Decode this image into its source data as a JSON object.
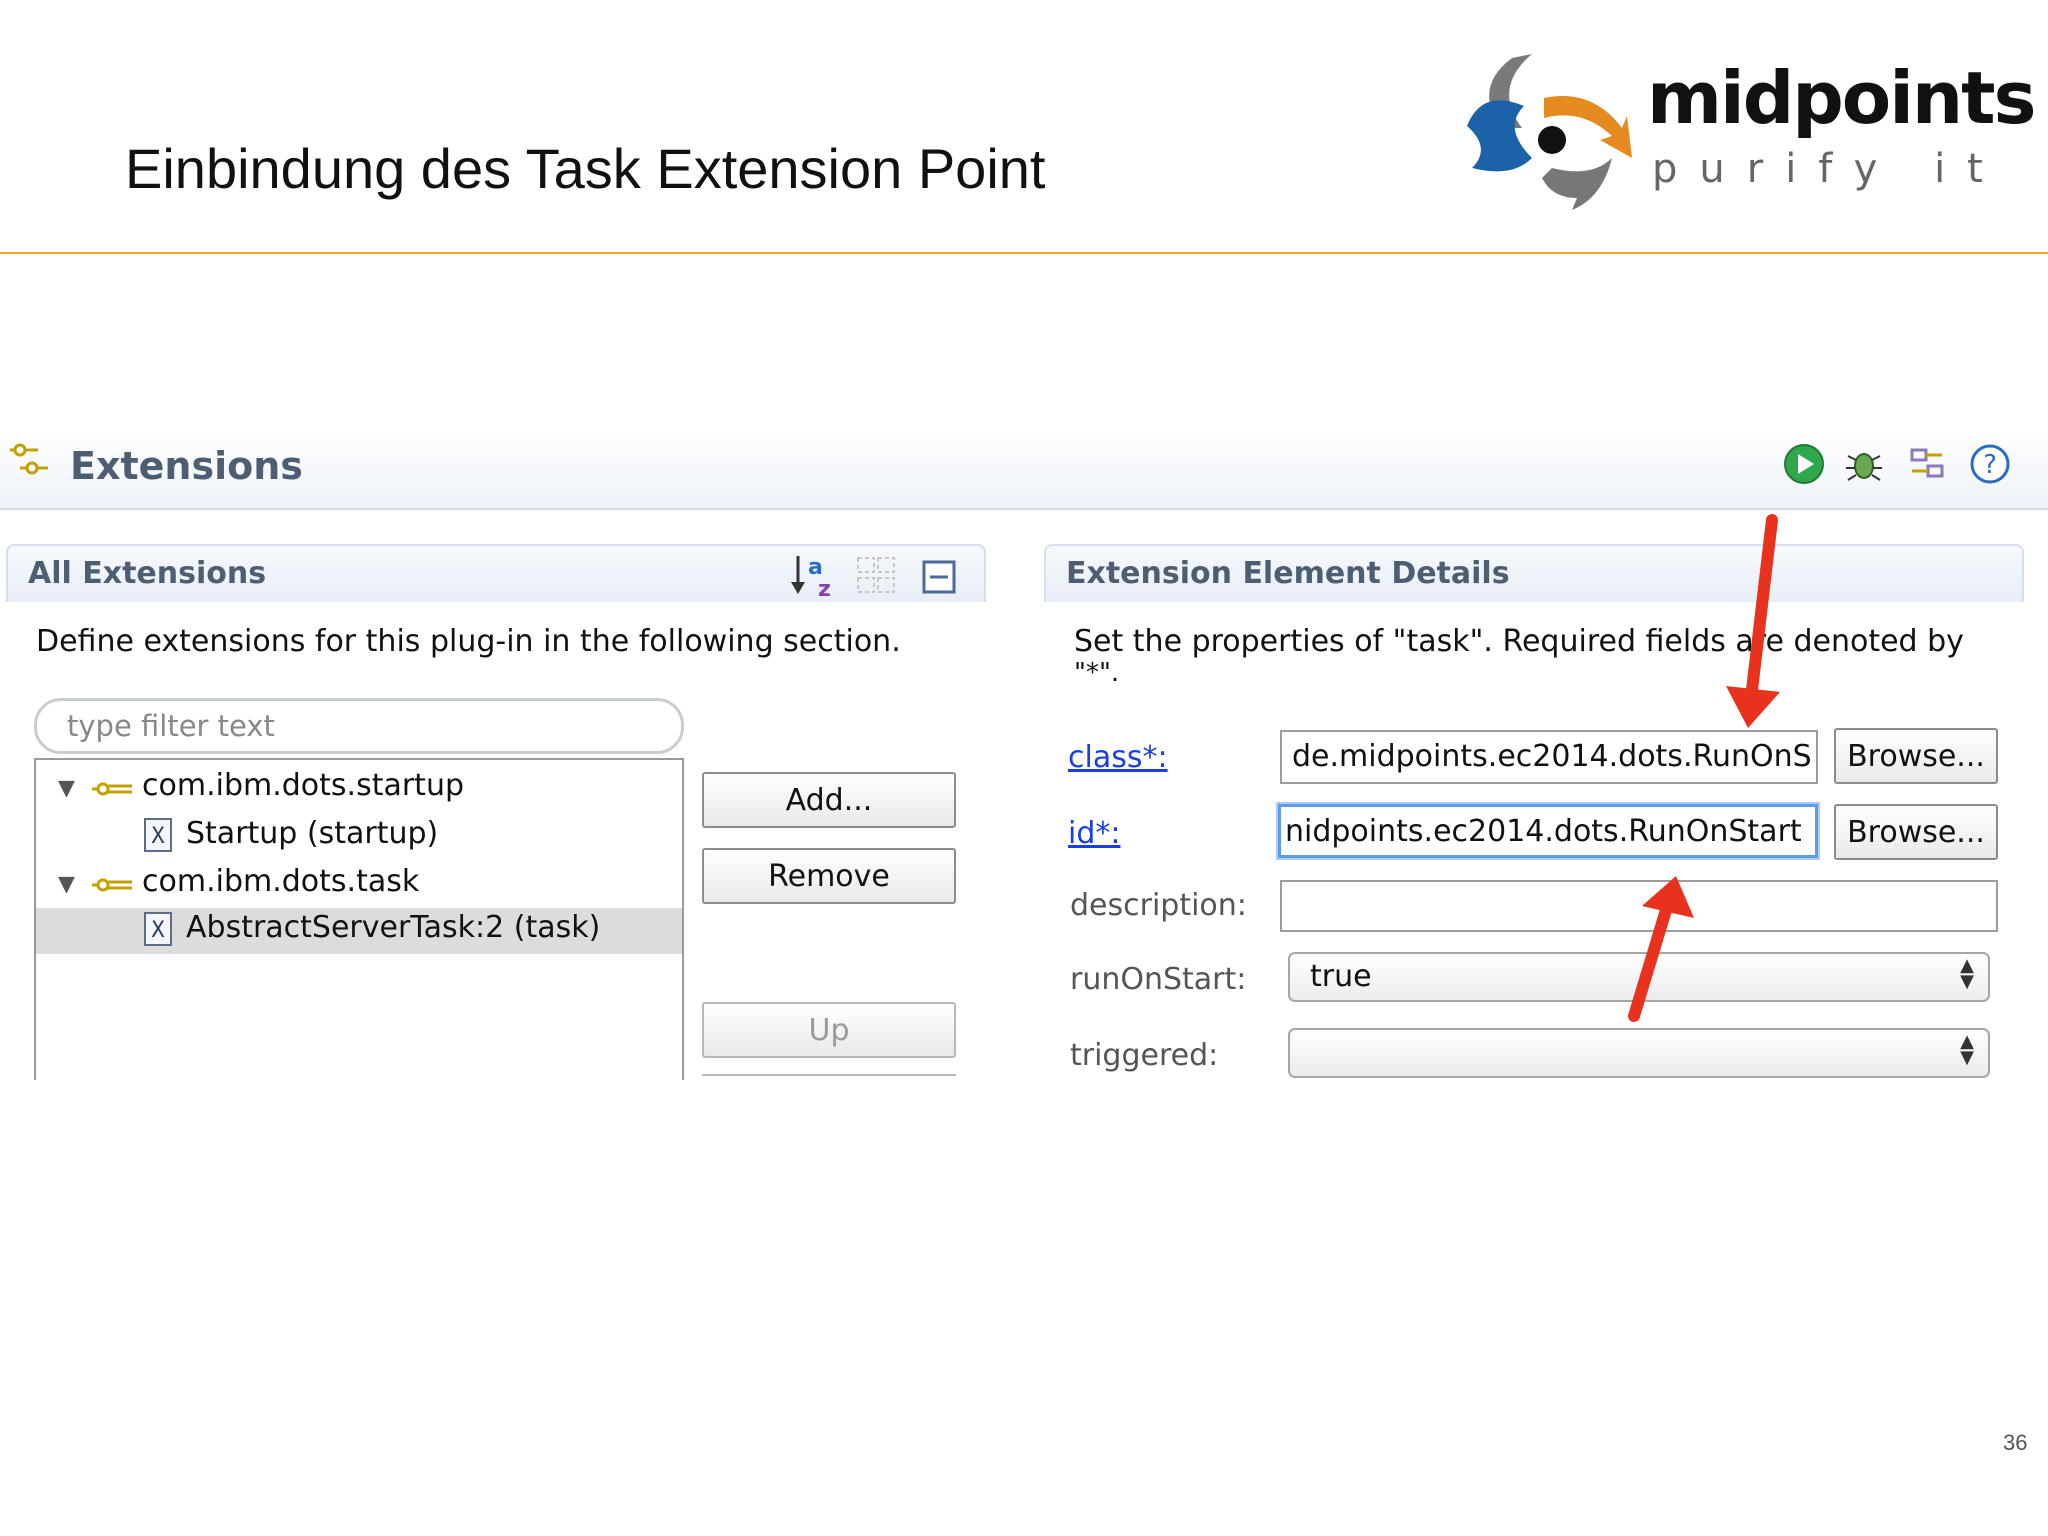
{
  "slide": {
    "title": "Einbindung des Task Extension Point",
    "number": "36",
    "logo": {
      "name": "midpoints",
      "tagline": "purify it"
    }
  },
  "editor": {
    "title": "Extensions",
    "toolbar_icons": [
      "run-icon",
      "debug-icon",
      "extension-wizard-icon",
      "help-icon"
    ]
  },
  "all_extensions": {
    "title": "All Extensions",
    "description": "Define extensions for this plug-in in the following section.",
    "filter_placeholder": "type filter text",
    "tree": [
      {
        "label": "com.ibm.dots.startup",
        "type": "extension",
        "expanded": true
      },
      {
        "label": "Startup (startup)",
        "type": "element"
      },
      {
        "label": "com.ibm.dots.task",
        "type": "extension",
        "expanded": true
      },
      {
        "label": "AbstractServerTask:2 (task)",
        "type": "element",
        "selected": true
      }
    ],
    "buttons": {
      "add": "Add...",
      "remove": "Remove",
      "up": "Up"
    }
  },
  "details": {
    "title": "Extension Element Details",
    "description_line1": "Set the properties of \"task\". Required fields are denoted by",
    "description_line2": "\"*\".",
    "fields": {
      "class_label": "class*:",
      "class_value": "de.midpoints.ec2014.dots.RunOnS",
      "id_label": "id*:",
      "id_value": "nidpoints.ec2014.dots.RunOnStart",
      "description_label": "description:",
      "description_value": "",
      "runonstart_label": "runOnStart:",
      "runonstart_value": "true",
      "triggered_label": "triggered:",
      "triggered_value": ""
    },
    "browse_label": "Browse..."
  },
  "colors": {
    "accent_rule": "#e8a820",
    "annotation_arrow": "#e8321e",
    "link": "#1a3fe0"
  }
}
